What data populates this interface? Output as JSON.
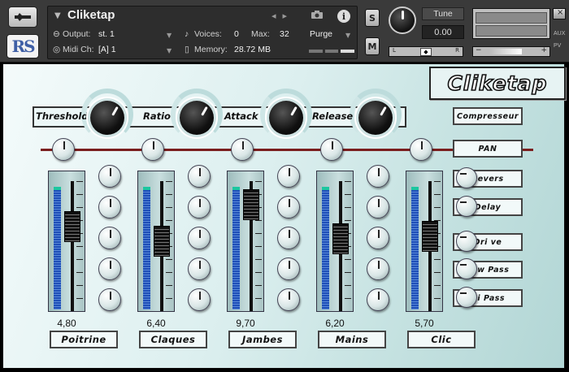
{
  "header": {
    "instrument_title": "Cliketap",
    "output_label": "Output:",
    "output_value": "st. 1",
    "voices_label": "Voices:",
    "voices_value": "0",
    "max_label": "Max:",
    "max_value": "32",
    "purge_label": "Purge",
    "midi_label": "Midi Ch:",
    "midi_value": "[A] 1",
    "memory_label": "Memory:",
    "memory_value": "28.72 MB",
    "s_button": "S",
    "m_button": "M",
    "tune_label": "Tune",
    "tune_value": "0.00",
    "pan_left": "L",
    "pan_right": "R",
    "aux_label": "AUX",
    "pv_label": "PV",
    "vol_minus": "−",
    "vol_plus": "+"
  },
  "logo_text": "Cliketap",
  "compressor": {
    "labels": [
      "Threshold",
      "Ratio",
      "Attack",
      "Release"
    ],
    "button": "Compresseur"
  },
  "channels": [
    {
      "name": "Poitrine",
      "value": "4,80",
      "fader_level": 0.7
    },
    {
      "name": "Claques",
      "value": "6,40",
      "fader_level": 0.55
    },
    {
      "name": "Jambes",
      "value": "9,70",
      "fader_level": 0.92
    },
    {
      "name": "Mains",
      "value": "6,20",
      "fader_level": 0.57
    },
    {
      "name": "Clic",
      "value": "5,70",
      "fader_level": 0.6
    }
  ],
  "fx": {
    "pan": "PAN",
    "revers": "Revers",
    "delay": "Delay",
    "drive": "Dri ve",
    "low_pass": "Low Pass",
    "hi_pass": "Hi Pass"
  },
  "colors": {
    "panel_bg": "#d9eded",
    "red_line": "#7a1e1e",
    "meter_blue": "#1f4fb8"
  }
}
